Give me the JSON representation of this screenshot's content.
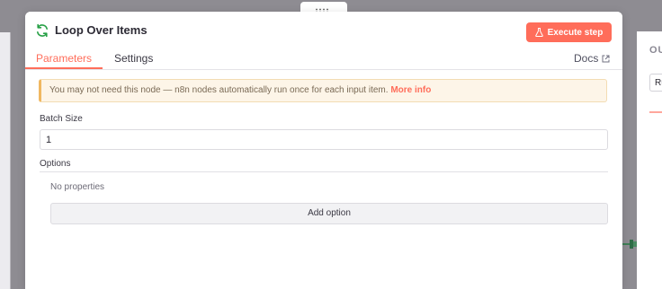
{
  "node": {
    "title": "Loop Over Items",
    "icon": "sync-icon",
    "icon_color": "#27a046"
  },
  "toolbar": {
    "execute_label": "Execute step",
    "execute_icon": "flask-icon",
    "accent_color": "#ff6d5a"
  },
  "tabs": [
    {
      "label": "Parameters",
      "active": true
    },
    {
      "label": "Settings",
      "active": false
    }
  ],
  "docs": {
    "label": "Docs",
    "icon": "external-link-icon"
  },
  "notice": {
    "text": "You may not need this node — n8n nodes automatically run once for each input item.",
    "link_label": "More info"
  },
  "fields": {
    "batch_size_label": "Batch Size",
    "batch_size_value": "1",
    "options_label": "Options",
    "no_properties_text": "No properties",
    "add_option_label": "Add option"
  },
  "output_panel": {
    "label": "OU",
    "run_value": "Ru"
  }
}
